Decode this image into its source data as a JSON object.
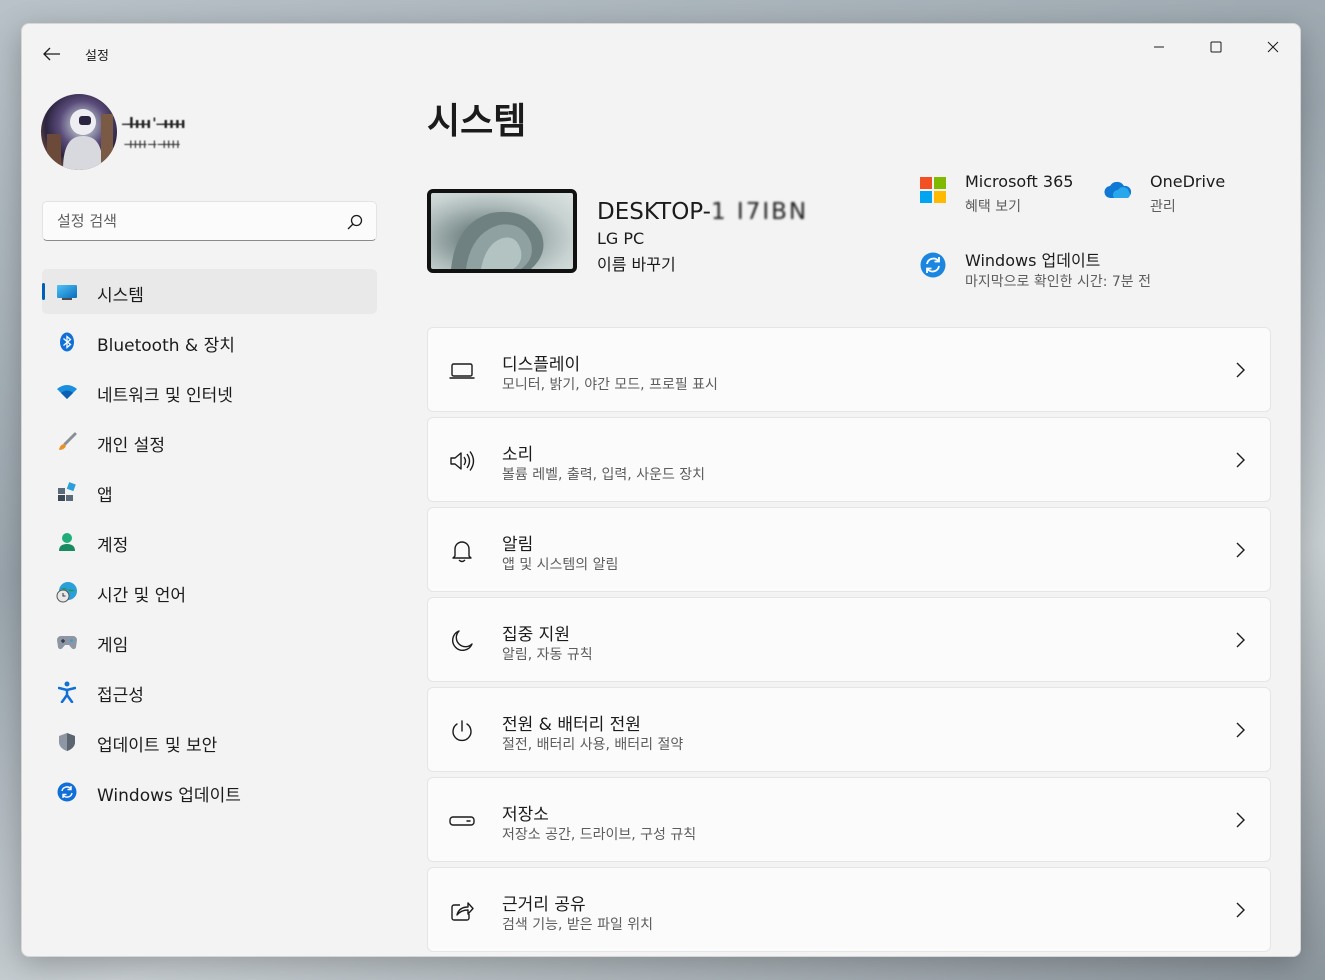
{
  "window": {
    "app_title": "설정",
    "controls": {
      "minimize": "minimize-icon",
      "maximize": "maximize-icon",
      "close": "close-icon"
    }
  },
  "profile": {
    "name": "l̶ı̶ı̶ı̶' ı̶ı̶ı̶ı̶",
    "email": "ı̶ı̶ı̶ı̶ ı̶ ı̶ı̶ı̶ı̶"
  },
  "search": {
    "placeholder": "설정 검색"
  },
  "sidebar": {
    "items": [
      {
        "label": "시스템",
        "icon": "system-icon",
        "selected": true
      },
      {
        "label": "Bluetooth & 장치",
        "icon": "bluetooth-icon"
      },
      {
        "label": "네트워크 및 인터넷",
        "icon": "wifi-icon"
      },
      {
        "label": "개인 설정",
        "icon": "brush-icon"
      },
      {
        "label": "앱",
        "icon": "apps-icon"
      },
      {
        "label": "계정",
        "icon": "account-icon"
      },
      {
        "label": "시간 및 언어",
        "icon": "globe-clock-icon"
      },
      {
        "label": "게임",
        "icon": "gamepad-icon"
      },
      {
        "label": "접근성",
        "icon": "accessibility-icon"
      },
      {
        "label": "업데이트 및 보안",
        "icon": "shield-icon"
      },
      {
        "label": "Windows 업데이트",
        "icon": "windows-update-icon"
      }
    ]
  },
  "main": {
    "title": "시스템",
    "device": {
      "name_prefix": "DESKTOP-",
      "name_masked": "1 I7IBN",
      "model": "LG PC",
      "rename": "이름 바꾸기"
    },
    "tiles": {
      "m365": {
        "title": "Microsoft 365",
        "sub": "혜택 보기"
      },
      "onedrive": {
        "title": "OneDrive",
        "sub": "관리"
      },
      "update": {
        "title": "Windows 업데이트",
        "sub": "마지막으로 확인한 시간: 7분 전"
      }
    },
    "settings": [
      {
        "title": "디스플레이",
        "sub": "모니터, 밝기, 야간 모드, 프로필 표시",
        "icon": "display-icon"
      },
      {
        "title": "소리",
        "sub": "볼륨 레벨, 출력, 입력, 사운드 장치",
        "icon": "speaker-icon"
      },
      {
        "title": "알림",
        "sub": "앱 및 시스템의 알림",
        "icon": "bell-icon"
      },
      {
        "title": "집중 지원",
        "sub": "알림, 자동 규칙",
        "icon": "moon-icon"
      },
      {
        "title": "전원 & 배터리 전원",
        "sub": "절전, 배터리 사용, 배터리 절약",
        "icon": "power-icon"
      },
      {
        "title": "저장소",
        "sub": "저장소 공간, 드라이브, 구성 규칙",
        "icon": "storage-icon"
      },
      {
        "title": "근거리 공유",
        "sub": "검색 기능, 받은 파일 위치",
        "icon": "share-icon"
      }
    ]
  },
  "colors": {
    "accent": "#005fb8",
    "window_bg": "#f3f3f3",
    "card_bg": "#fbfbfb",
    "text_primary": "#1b1b1b",
    "text_secondary": "#5d5d5d"
  }
}
